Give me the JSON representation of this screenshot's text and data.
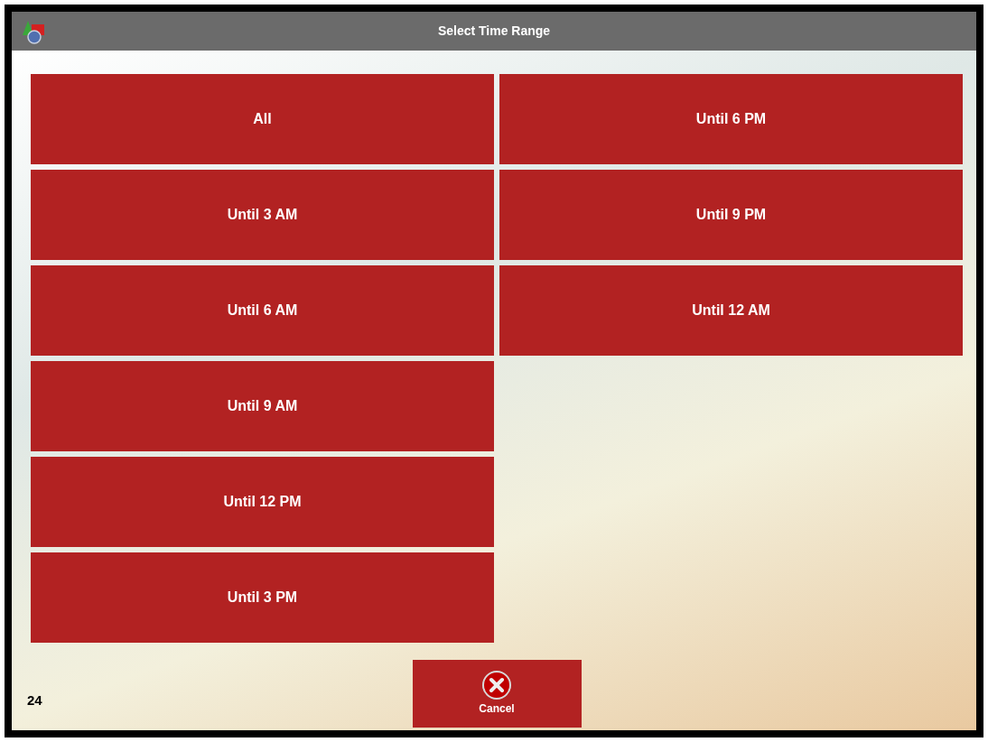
{
  "window": {
    "title": "Select Time Range"
  },
  "options": [
    {
      "label": "All"
    },
    {
      "label": "Until 3 AM"
    },
    {
      "label": "Until 6 AM"
    },
    {
      "label": "Until 9 AM"
    },
    {
      "label": "Until 12 PM"
    },
    {
      "label": "Until 3 PM"
    },
    {
      "label": "Until 6 PM"
    },
    {
      "label": "Until 9 PM"
    },
    {
      "label": "Until 12 AM"
    }
  ],
  "cancel_button": {
    "label": "Cancel"
  },
  "count": "24"
}
